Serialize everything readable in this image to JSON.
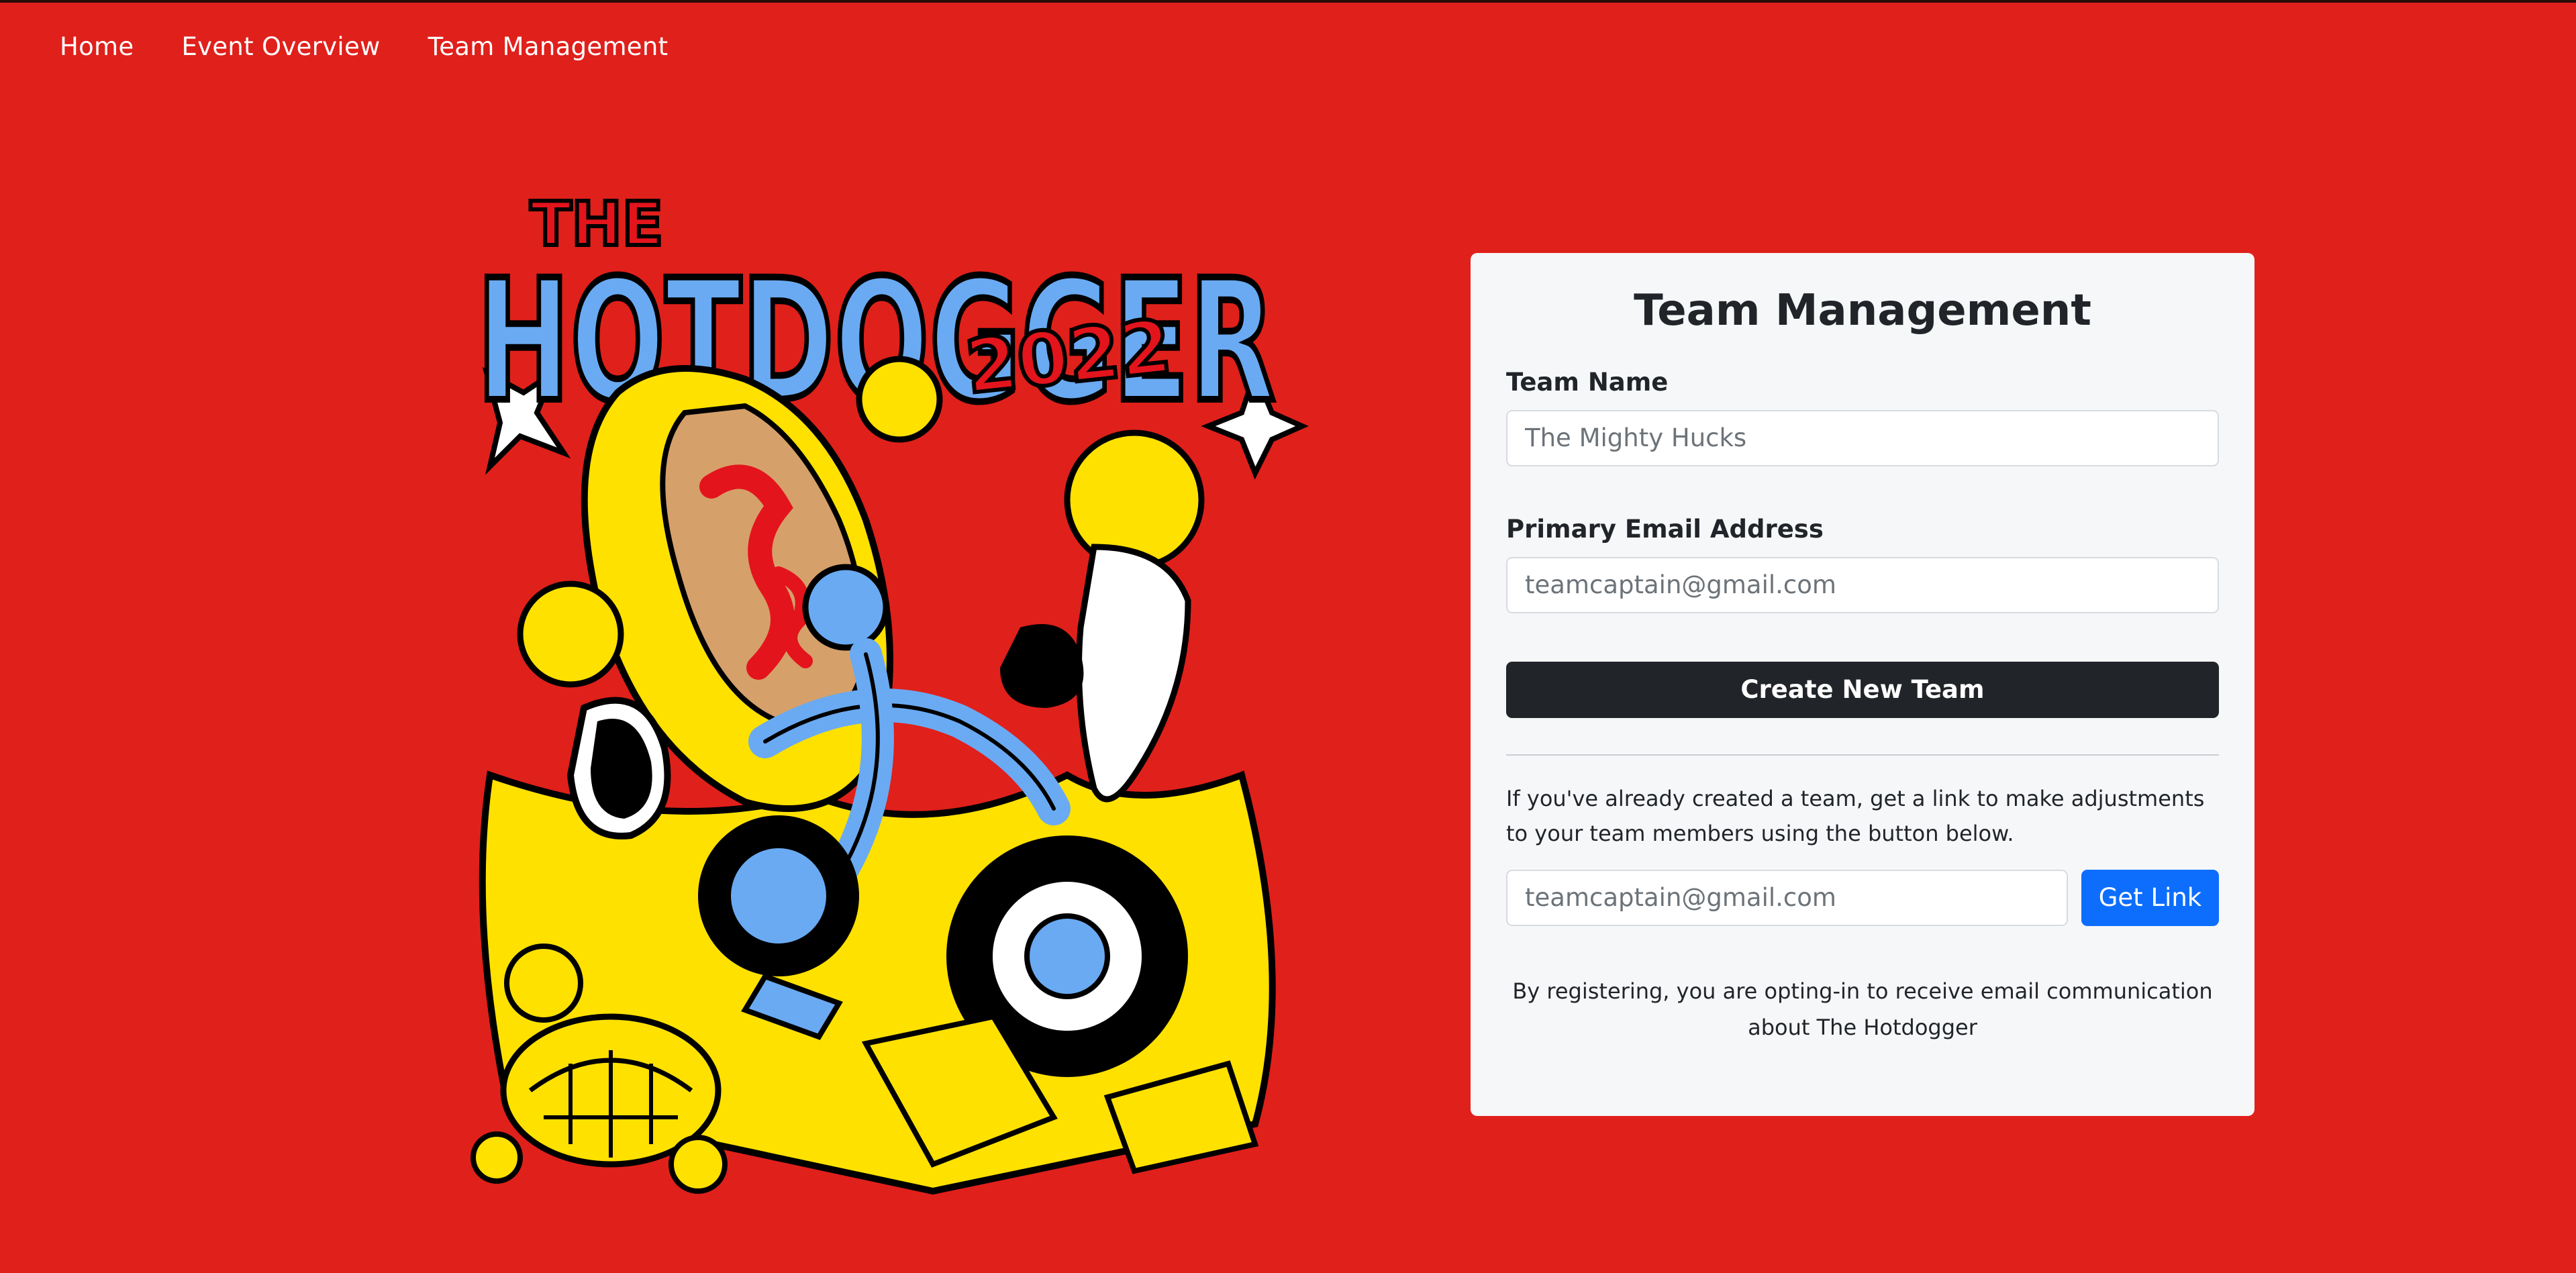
{
  "nav": {
    "items": [
      {
        "label": "Home"
      },
      {
        "label": "Event Overview"
      },
      {
        "label": "Team Management"
      }
    ]
  },
  "hero": {
    "logo_text": {
      "line1": "THE",
      "line2": "HOTDOGGER",
      "year": "2022"
    }
  },
  "card": {
    "title": "Team Management",
    "team_name": {
      "label": "Team Name",
      "placeholder": "The Mighty Hucks"
    },
    "email": {
      "label": "Primary Email Address",
      "placeholder": "teamcaptain@gmail.com"
    },
    "create_button": "Create New Team",
    "help_text": "If you've already created a team, get a link to make adjustments to your team members using the button below.",
    "link_email": {
      "placeholder": "teamcaptain@gmail.com"
    },
    "get_link_button": "Get Link",
    "note": "By registering, you are opting-in to receive email communication about The Hotdogger"
  },
  "colors": {
    "background": "#e0201b",
    "card": "#f6f7f9",
    "dark_button": "#212529",
    "primary_button": "#0d6efd",
    "art_blue": "#6aaaf2",
    "art_yellow": "#ffe100",
    "art_red": "#e3141c"
  }
}
